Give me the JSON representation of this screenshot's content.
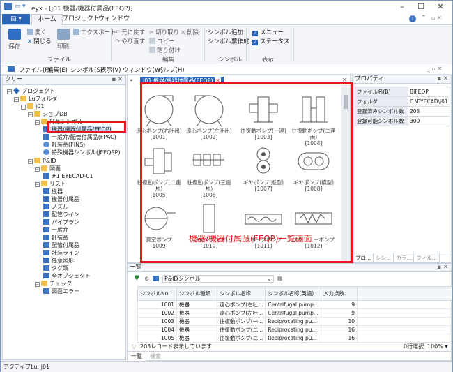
{
  "app": {
    "title": "eyx - [j01 機器/機器付属品(FEQP)]",
    "file_button": "",
    "tabs": [
      "ホーム",
      "プロジェクト",
      "ウィンドウ"
    ]
  },
  "ribbon": {
    "file_group": {
      "save": "保存",
      "open": "開く",
      "close": "閉じる",
      "print": "印刷",
      "export": "エクスポート",
      "label": "ファイル"
    },
    "edit_group": {
      "undo": "元に戻す",
      "redo": "やり直す",
      "cut": "切り取り",
      "delete": "削除",
      "copy": "コピー",
      "paste": "貼り付け",
      "label": "編集"
    },
    "symbol_group": {
      "add": "シンボル追加",
      "create": "シンボル票作成",
      "label": "シンボル"
    },
    "display_group": {
      "menu": "メニュー",
      "status": "ステータス",
      "label": "表示"
    }
  },
  "menubar": [
    "ファイル(F)",
    "編集(E)",
    "シンボル(S)",
    "表示(V)",
    "ウィンドウ(W)",
    "ヘルプ(H)"
  ],
  "tree": {
    "header": "ツリー",
    "nodes": [
      "プロジェクト",
      "Luフォルダ",
      "j01",
      "ジョブDB",
      "部品シンボル",
      "機器/機器付属品(FEQP)",
      "一般弁/配管付属品(FPAC)",
      "計装品(FINS)",
      "特殊機器シンボル(JFEQSP)",
      "P&ID",
      "図面",
      "#1 EYECAD-01",
      "リスト",
      "機器",
      "機器付属品",
      "ノズル",
      "配管ライン",
      "パイプラン",
      "一般弁",
      "計装品",
      "配管付属品",
      "計装ライン",
      "任意図形",
      "タグ類",
      "全オブジェクト",
      "チェック",
      "図面エラー"
    ]
  },
  "document": {
    "tab": "j01 機器/機器付属品(FEQP)",
    "symbols": [
      {
        "name": "遠心ポンプ(右吐出)",
        "id": "[1001]"
      },
      {
        "name": "遠心ポンプ(左吐出)",
        "id": "[1002]"
      },
      {
        "name": "往復動ポンプ(一連)",
        "id": "[1003]"
      },
      {
        "name": "往復動ポンプ(二連両)",
        "id": "[1004]"
      },
      {
        "name": "往復動ポンプ(二連片)",
        "id": "[1005]"
      },
      {
        "name": "往復動ポンプ(三連片)",
        "id": "[1006]"
      },
      {
        "name": "ギヤポンプ(縦型)",
        "id": "[1007]"
      },
      {
        "name": "ギヤポンプ(横型)",
        "id": "[1008]"
      },
      {
        "name": "真空ポンプ",
        "id": "[1009]"
      },
      {
        "name": "ラインポンプ",
        "id": "[1010]"
      },
      {
        "name": "スネークポンプ",
        "id": "[1011]"
      },
      {
        "name": "スクリューポンプ",
        "id": "[1012]"
      }
    ],
    "callout": "機器/機器付属品(FEQP)一覧画面"
  },
  "properties": {
    "header": "プロパティ",
    "rows": [
      {
        "k": "ファイル名(B)",
        "v": "BIFEQP"
      },
      {
        "k": "フォルダ",
        "v": "C:\\EYECAD\\j01"
      },
      {
        "k": "登録済みシンボル数",
        "v": "203"
      },
      {
        "k": "登録可能シンボル数",
        "v": "300"
      }
    ],
    "bottom_tabs": [
      "プロ...",
      "シン...",
      "カラ...",
      "フィル...",
      "カラ..."
    ]
  },
  "list": {
    "header": "一覧",
    "filter": "P&IDシンボル",
    "columns": [
      "シンボルNo.",
      "シンボル種類",
      "シンボル名称",
      "シンボル名称(英語)",
      "入力点数"
    ],
    "rows": [
      [
        "1001",
        "機器",
        "遠心ポンプ(右吐...",
        "Centrifugal pump...",
        "9"
      ],
      [
        "1002",
        "機器",
        "遠心ポンプ(左吐...",
        "Centrifugal pump...",
        "9"
      ],
      [
        "1003",
        "機器",
        "往復動ポンプ(一...",
        "Reciprocating pu...",
        "10"
      ],
      [
        "1004",
        "機器",
        "往復動ポンプ(二...",
        "Reciprocating pu...",
        "16"
      ],
      [
        "1005",
        "機器",
        "往復動ポンプ(二...",
        "Reciprocating pu...",
        "16"
      ]
    ],
    "status_left": "203レコード表示しています",
    "status_right": "0行選択",
    "zoom": "100%",
    "tabs": [
      "一覧",
      "検索"
    ]
  },
  "status": "アクティブLu: j01",
  "colors": {
    "accent": "#2b63b8",
    "highlight": "#e8161c"
  }
}
